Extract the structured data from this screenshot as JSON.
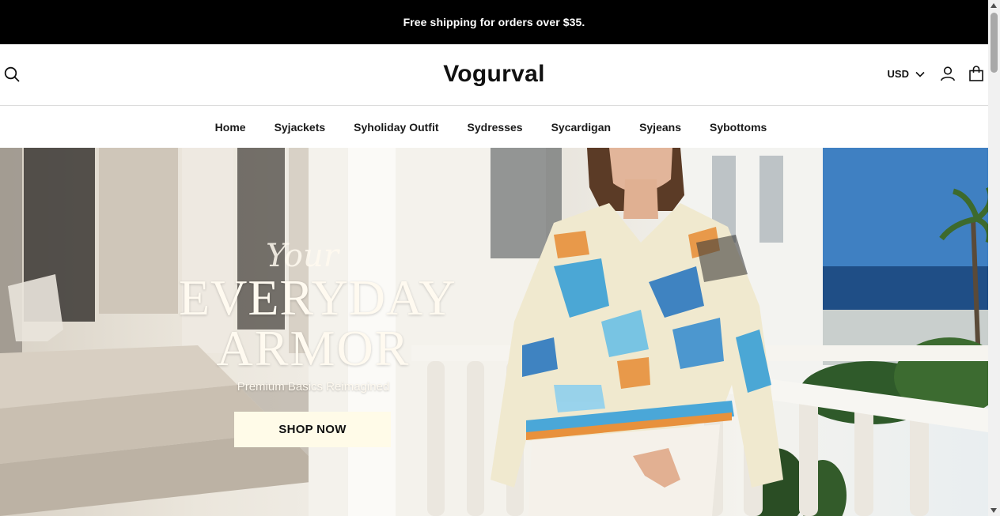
{
  "announcement": {
    "text": "Free shipping for orders over $35."
  },
  "header": {
    "logo": "Vogurval",
    "currency": "USD",
    "icons": [
      "search-icon",
      "chevron-down-icon",
      "account-icon",
      "cart-icon"
    ]
  },
  "nav": {
    "items": [
      {
        "label": "Home"
      },
      {
        "label": "Syjackets"
      },
      {
        "label": "Syholiday Outfit"
      },
      {
        "label": "Sydresses"
      },
      {
        "label": "Sycardigan"
      },
      {
        "label": "Syjeans"
      },
      {
        "label": "Sybottoms"
      }
    ]
  },
  "hero": {
    "script": "Your",
    "headline_line1": "EVERYDAY",
    "headline_line2": "ARMOR",
    "subtitle": "Premium Basics Reimagined",
    "cta": "SHOP NOW"
  },
  "colors": {
    "announcement_bg": "#000000",
    "cta_bg": "#fffbe8",
    "hero_text": "#fffaf0"
  }
}
